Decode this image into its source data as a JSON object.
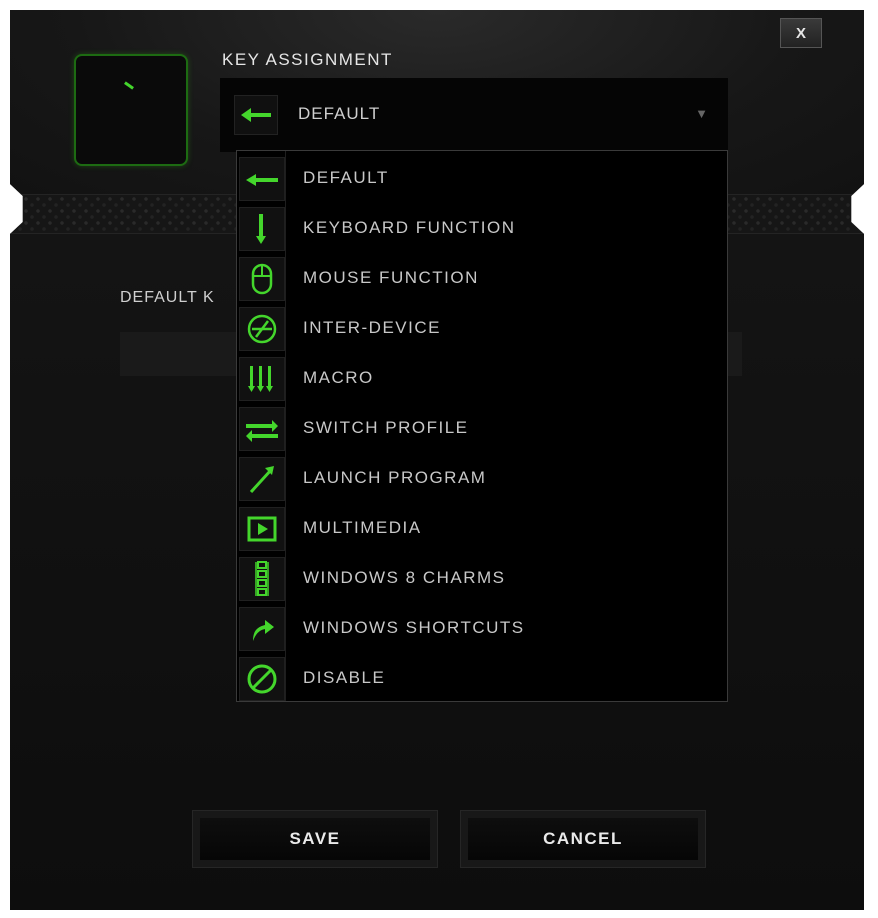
{
  "window": {
    "close_label": "X"
  },
  "key_assignment": {
    "title": "KEY ASSIGNMENT",
    "selected": "DEFAULT",
    "selected_icon": "arrow-left-icon"
  },
  "default_key": {
    "label_visible": "DEFAULT K"
  },
  "menu": {
    "items": [
      {
        "label": "DEFAULT",
        "icon": "arrow-left-icon"
      },
      {
        "label": "KEYBOARD FUNCTION",
        "icon": "keyboard-function-icon"
      },
      {
        "label": "MOUSE FUNCTION",
        "icon": "mouse-icon"
      },
      {
        "label": "INTER-DEVICE",
        "icon": "inter-device-icon"
      },
      {
        "label": "MACRO",
        "icon": "macro-icon"
      },
      {
        "label": "SWITCH PROFILE",
        "icon": "switch-profile-icon"
      },
      {
        "label": "LAUNCH PROGRAM",
        "icon": "launch-program-icon"
      },
      {
        "label": "MULTIMEDIA",
        "icon": "multimedia-icon"
      },
      {
        "label": "WINDOWS 8 CHARMS",
        "icon": "windows-charms-icon"
      },
      {
        "label": "WINDOWS SHORTCUTS",
        "icon": "windows-shortcuts-icon"
      },
      {
        "label": "DISABLE",
        "icon": "disable-icon"
      }
    ]
  },
  "buttons": {
    "save": "SAVE",
    "cancel": "CANCEL"
  },
  "colors": {
    "accent": "#44d62c",
    "background": "#111111",
    "text": "#c8c8c8"
  }
}
